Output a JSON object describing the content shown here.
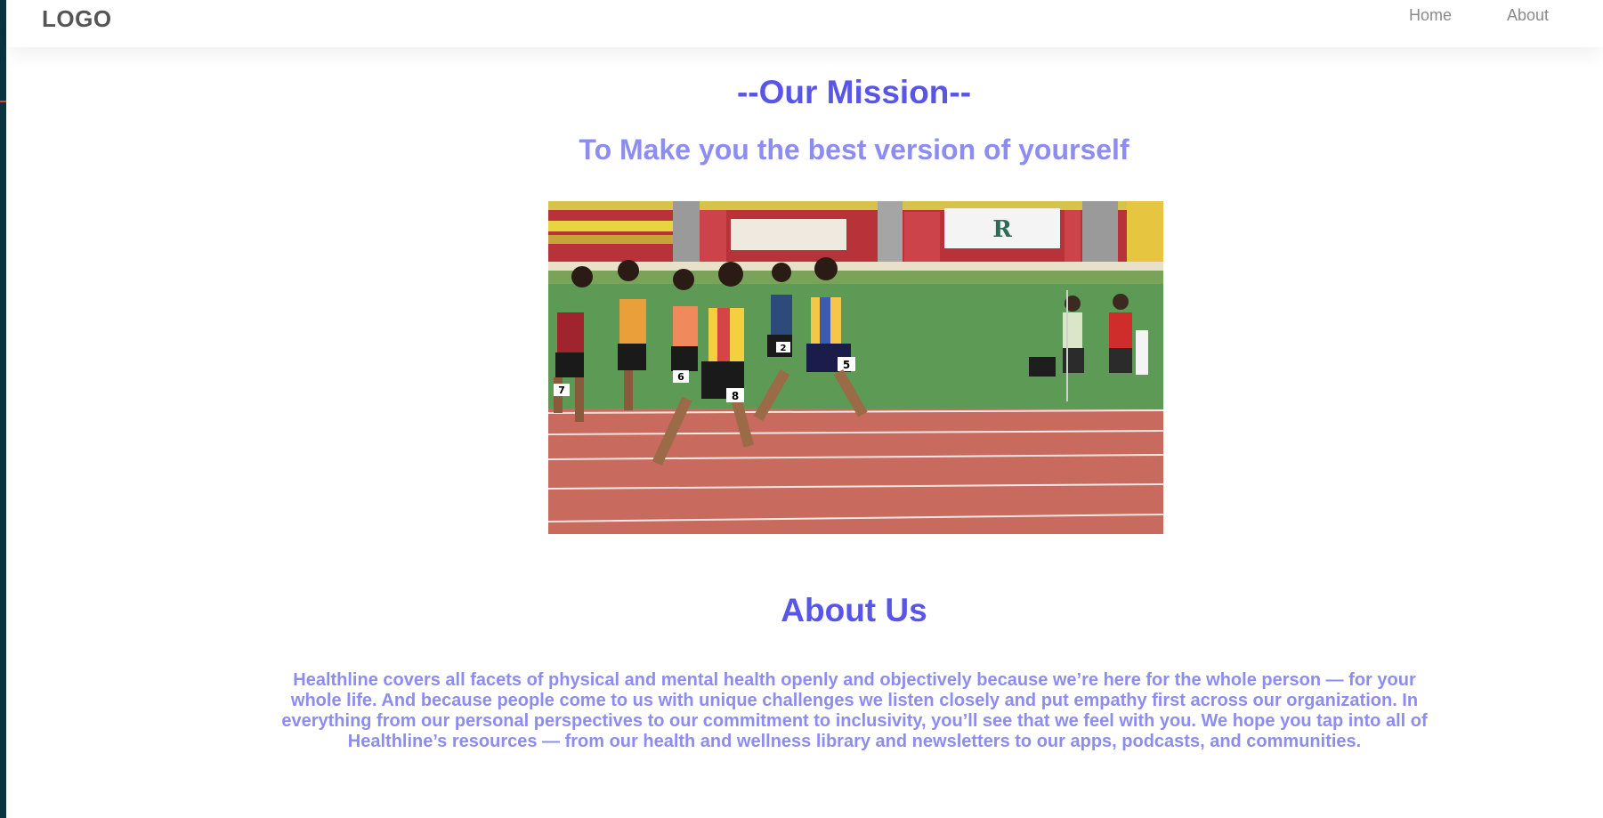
{
  "navbar": {
    "logo": "LOGO",
    "links": [
      {
        "label": "Home"
      },
      {
        "label": "About"
      }
    ]
  },
  "mission": {
    "title": "--Our Mission--",
    "subtitle": "To Make you the best version of yourself"
  },
  "hero_image": {
    "subject": "sprinters racing on a red running track in a stadium",
    "bib_numbers": [
      "7",
      "6",
      "8",
      "2",
      "5"
    ]
  },
  "about": {
    "title": "About Us",
    "body": "Healthline covers all facets of physical and mental health openly and objectively because we’re here for the whole person — for your whole life. And because people come to us with unique challenges we listen closely and put empathy first across our organization. In everything from our personal perspectives to our commitment to inclusivity, you’ll see that we feel with you. We hope you tap into all of Healthline’s resources — from our health and wellness library and newsletters to our apps, podcasts, and communities."
  },
  "colors": {
    "heading": "#5855e8",
    "subheading": "#8d8cf0",
    "nav_text": "#8a8a8a",
    "logo": "#555555",
    "sidebar_edge": "#0b3440"
  }
}
